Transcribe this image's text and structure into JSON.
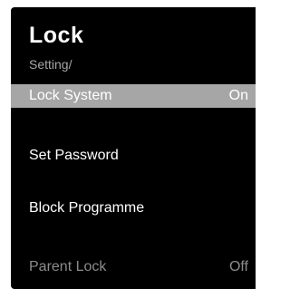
{
  "header": {
    "title": "Lock",
    "breadcrumb": "Setting/"
  },
  "menu": {
    "items": [
      {
        "label": "Lock System",
        "value": "On",
        "state": "selected"
      },
      {
        "label": "Set Password",
        "value": "",
        "state": "normal"
      },
      {
        "label": "Block Programme",
        "value": "",
        "state": "normal"
      },
      {
        "label": "Parent Lock",
        "value": "Off",
        "state": "disabled"
      }
    ]
  },
  "colors": {
    "background": "#000000",
    "text": "#ffffff",
    "highlight": "#a6a6a6",
    "disabled_text": "#8c8c8c"
  }
}
